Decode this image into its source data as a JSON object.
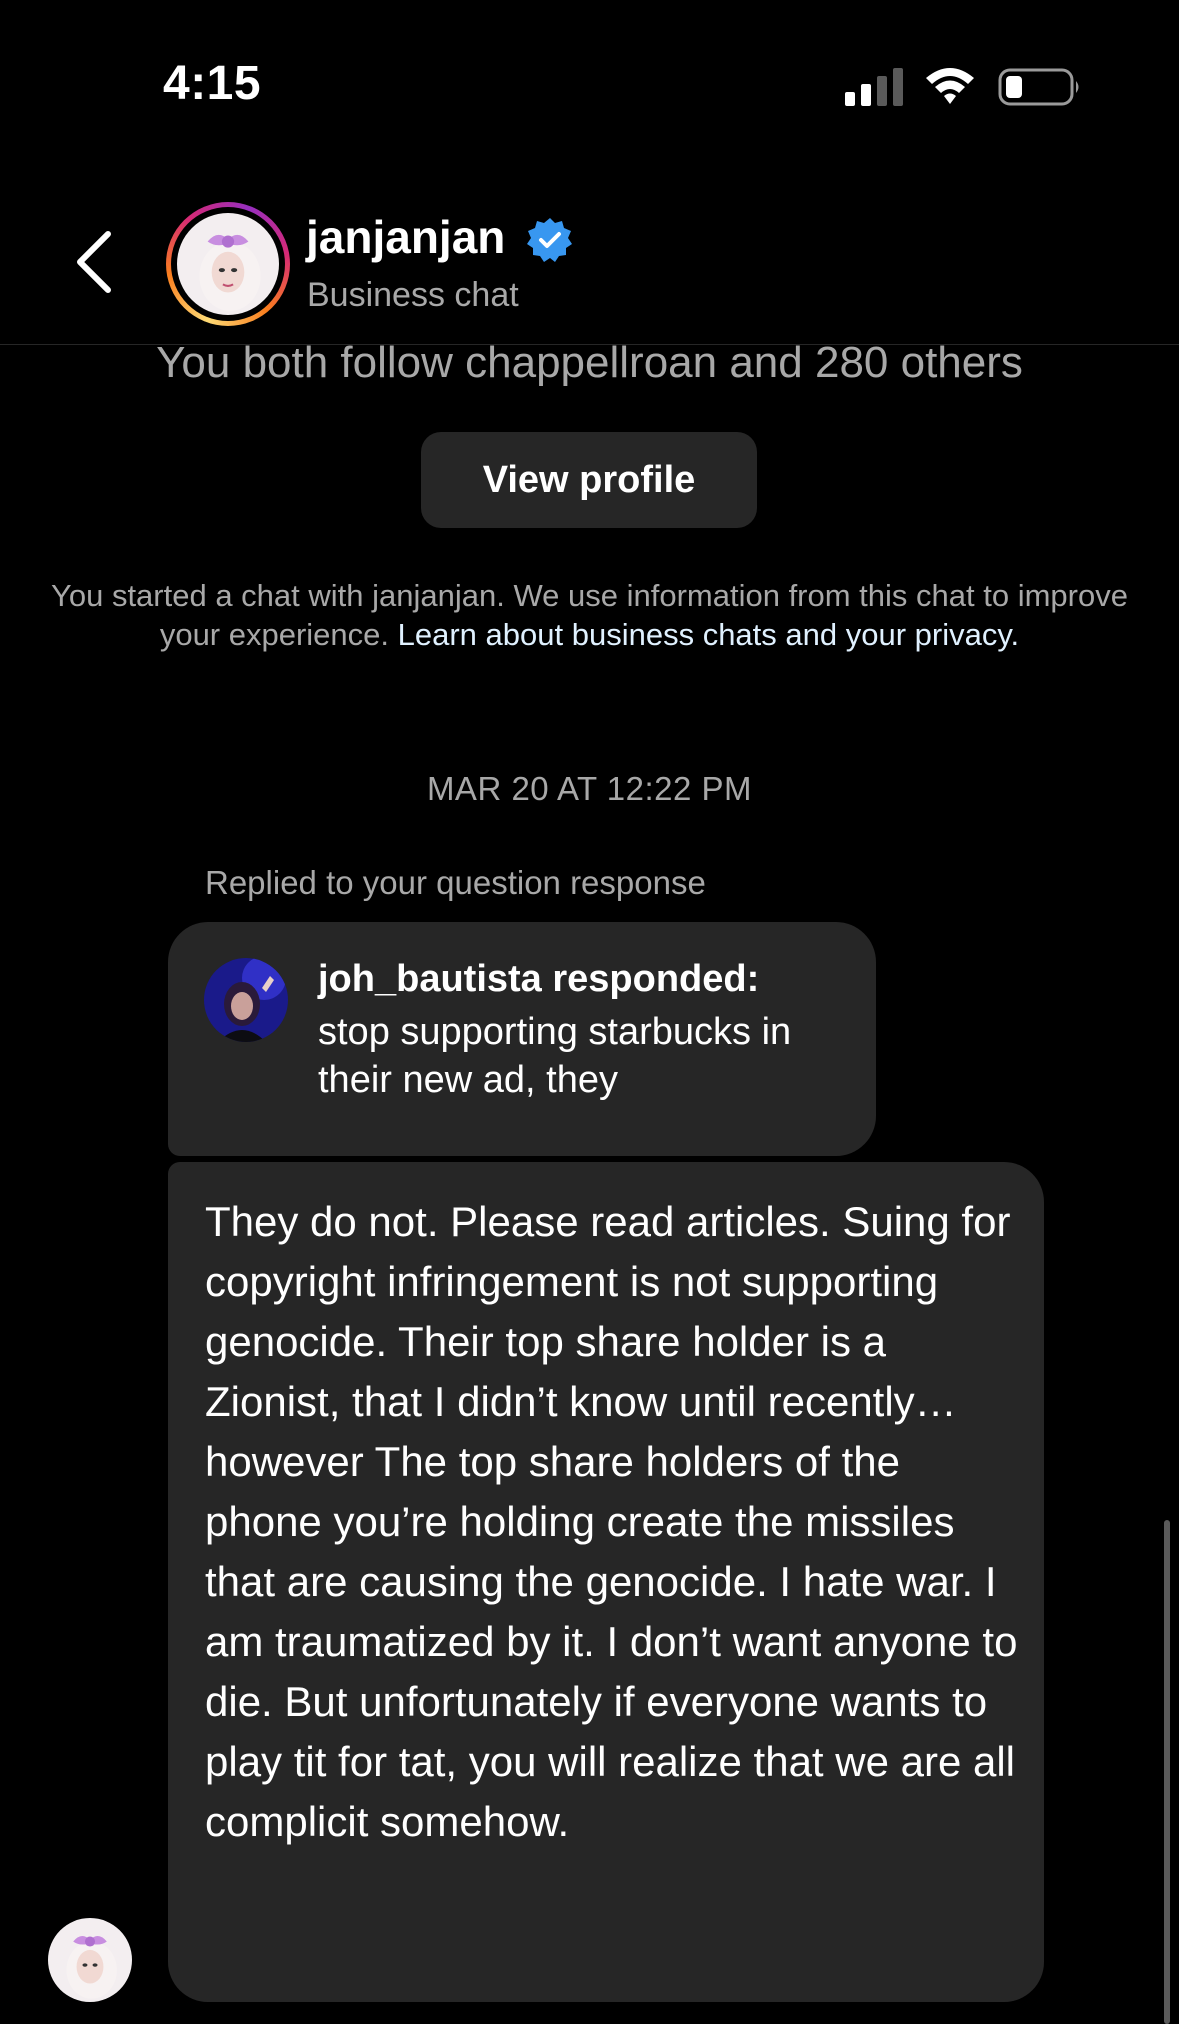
{
  "status_bar": {
    "time": "4:15"
  },
  "header": {
    "name": "janjanjan",
    "subtitle": "Business chat",
    "verified_icon": "verified-badge-icon",
    "colors": {
      "verified": "#3897f0"
    }
  },
  "profile_summary": {
    "mutual": "You both follow chappellroan and 280 others",
    "view_profile_label": "View profile"
  },
  "notice": {
    "text": "You started a chat with janjanjan. We use information from this chat to improve your experience.",
    "link": "Learn about business chats and your privacy."
  },
  "thread": {
    "timestamp": "MAR 20 AT 12:22 PM",
    "reply_context": "Replied to your question response",
    "reply": {
      "username": "joh_bautista responded:",
      "text": "stop supporting starbucks in their new ad, they"
    },
    "message": "They do not. Please read articles. Suing for copyright infringement is not supporting genocide. Their top share holder is a Zionist, that I didn’t know until recently… however The top share holders of the phone you’re holding create the missiles that are causing the genocide. I hate war. I am traumatized by it. I don’t want anyone to die. But unfortunately if everyone wants to play tit for tat, you will realize that we are all complicit somehow."
  }
}
